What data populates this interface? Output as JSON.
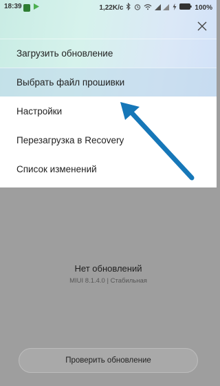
{
  "status_bar": {
    "time": "18:39",
    "speed": "1,22K/c",
    "battery": "100%",
    "icons": [
      "notification-icon",
      "playstore-icon",
      "bluetooth-icon",
      "alarm-icon",
      "wifi-icon",
      "signal-icon",
      "charging-icon",
      "battery-icon"
    ]
  },
  "menu": {
    "items": [
      {
        "label": "Загрузить обновление"
      },
      {
        "label": "Выбрать файл прошивки"
      },
      {
        "label": "Настройки"
      },
      {
        "label": "Перезагрузка в Recovery"
      },
      {
        "label": "Список изменений"
      }
    ],
    "selected_index": 1
  },
  "main": {
    "status_title": "Нет обновлений",
    "version": "MIUI 8.1.4.0 | Стабильная",
    "check_button": "Проверить обновление"
  },
  "colors": {
    "accent_arrow": "#1677b8",
    "overlay_gray": "#9e9e9e"
  }
}
